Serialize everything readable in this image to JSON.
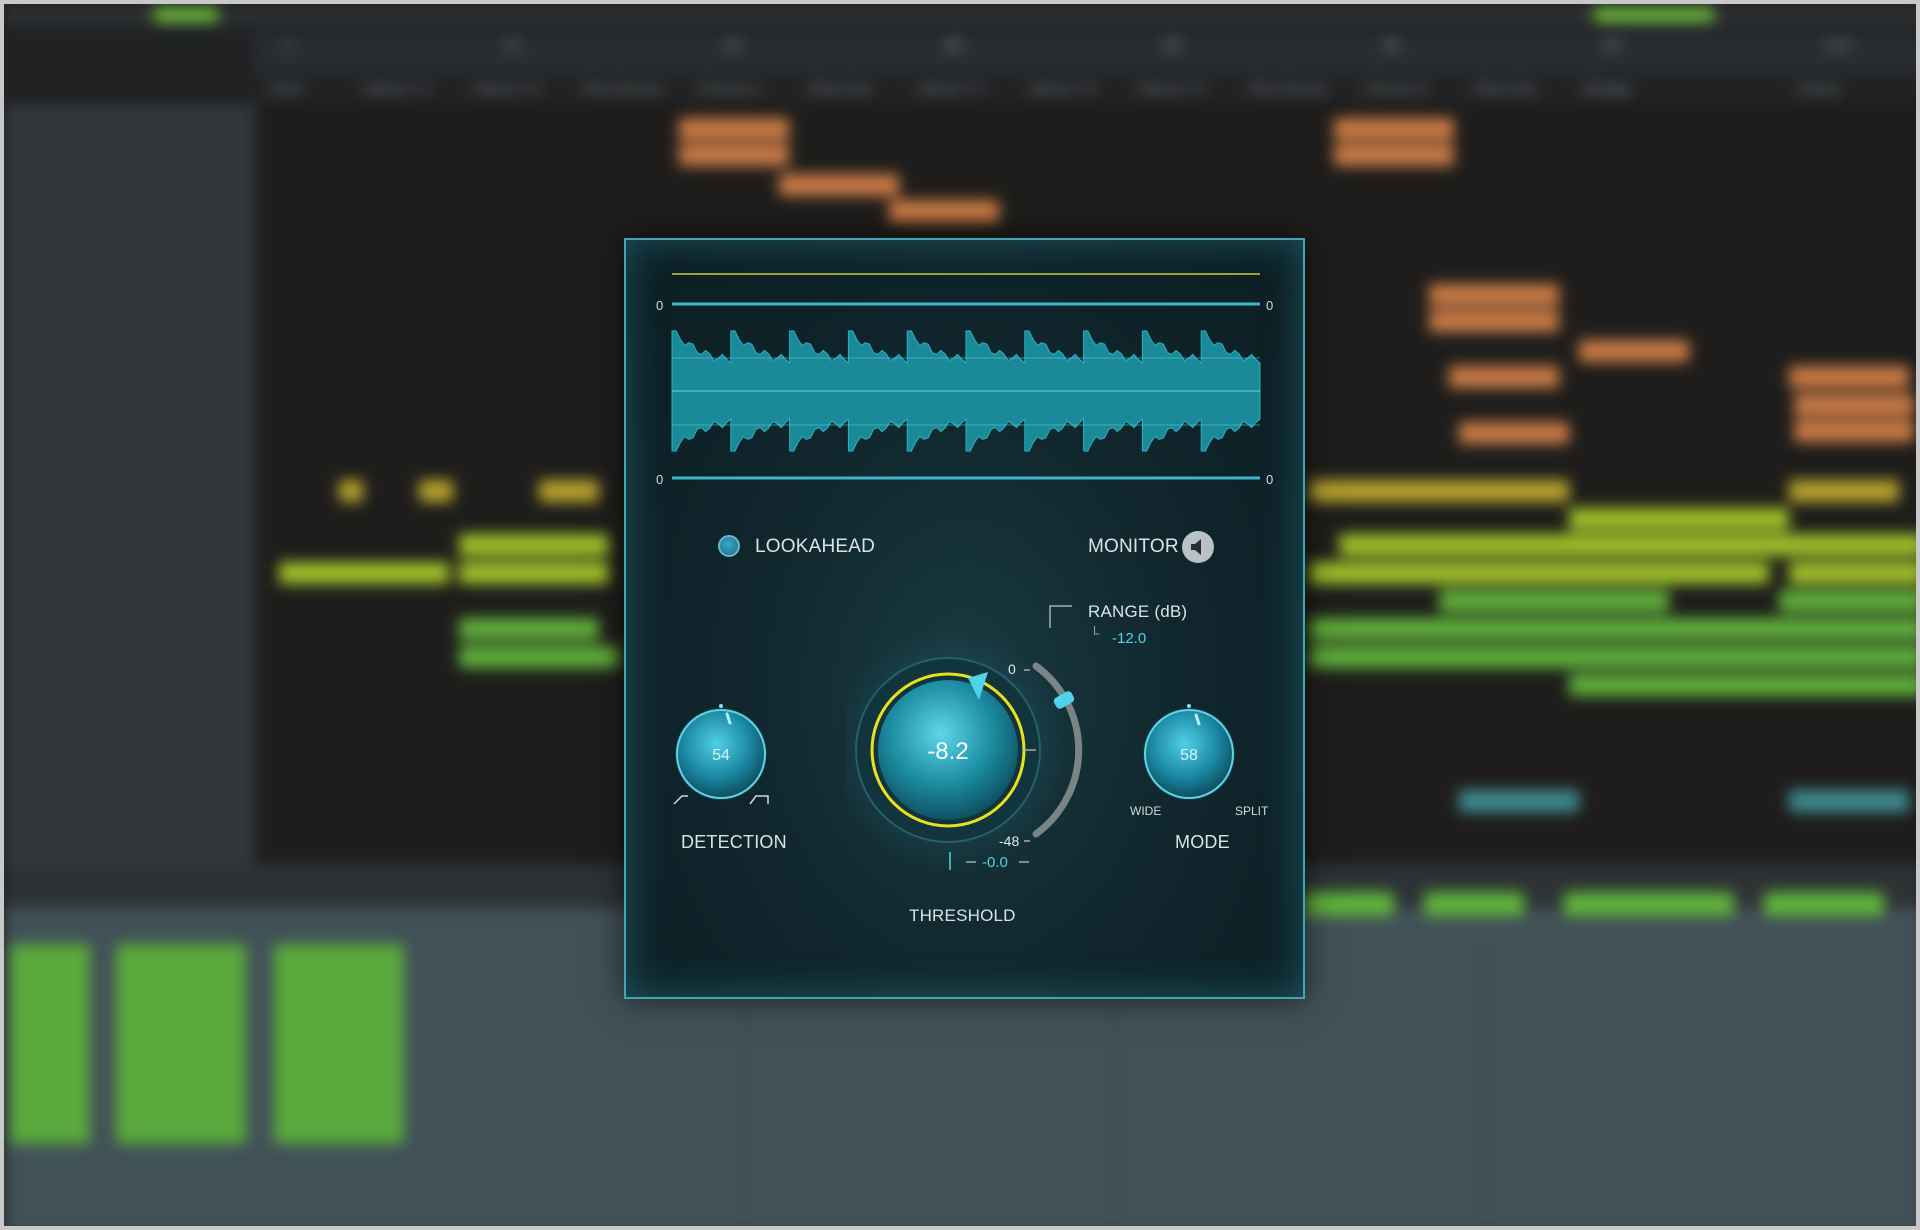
{
  "daw": {
    "ruler_ticks": [
      "1",
      "17",
      "33",
      "49",
      "65",
      "81",
      "97",
      "113"
    ],
    "markers": [
      "Intro",
      "Verse 1 1",
      "Verse 1 2",
      "Pre-Chorus",
      "Chorus 1",
      "Post-Cho",
      "Verse 2 1",
      "Verse 2 2",
      "Verse 2 3",
      "Pre-Chorus",
      "Chorus 2",
      "Post-Cho",
      "Bridge",
      "Outro"
    ]
  },
  "plugin": {
    "meter": {
      "scale_top_left": "0",
      "scale_top_right": "0",
      "scale_bottom_left": "0",
      "scale_bottom_right": "0",
      "line_color": "#3ab7cc",
      "wave_color": "#1a8a98",
      "ceiling_color": "#c8cf3a"
    },
    "lookahead": {
      "label": "LOOKAHEAD",
      "enabled": false
    },
    "monitor": {
      "label": "MONITOR",
      "icon": "speaker-icon"
    },
    "range": {
      "label": "RANGE (dB)",
      "value": "-12.0",
      "scale_max": "0",
      "scale_min": "-48"
    },
    "threshold": {
      "label": "THRESHOLD",
      "value": "-8.2",
      "readout": "-0.0",
      "ring_color": "#e8e21e"
    },
    "detection": {
      "label": "DETECTION",
      "value": "54"
    },
    "mode": {
      "label": "MODE",
      "value": "58",
      "left_label": "WIDE",
      "right_label": "SPLIT"
    }
  }
}
